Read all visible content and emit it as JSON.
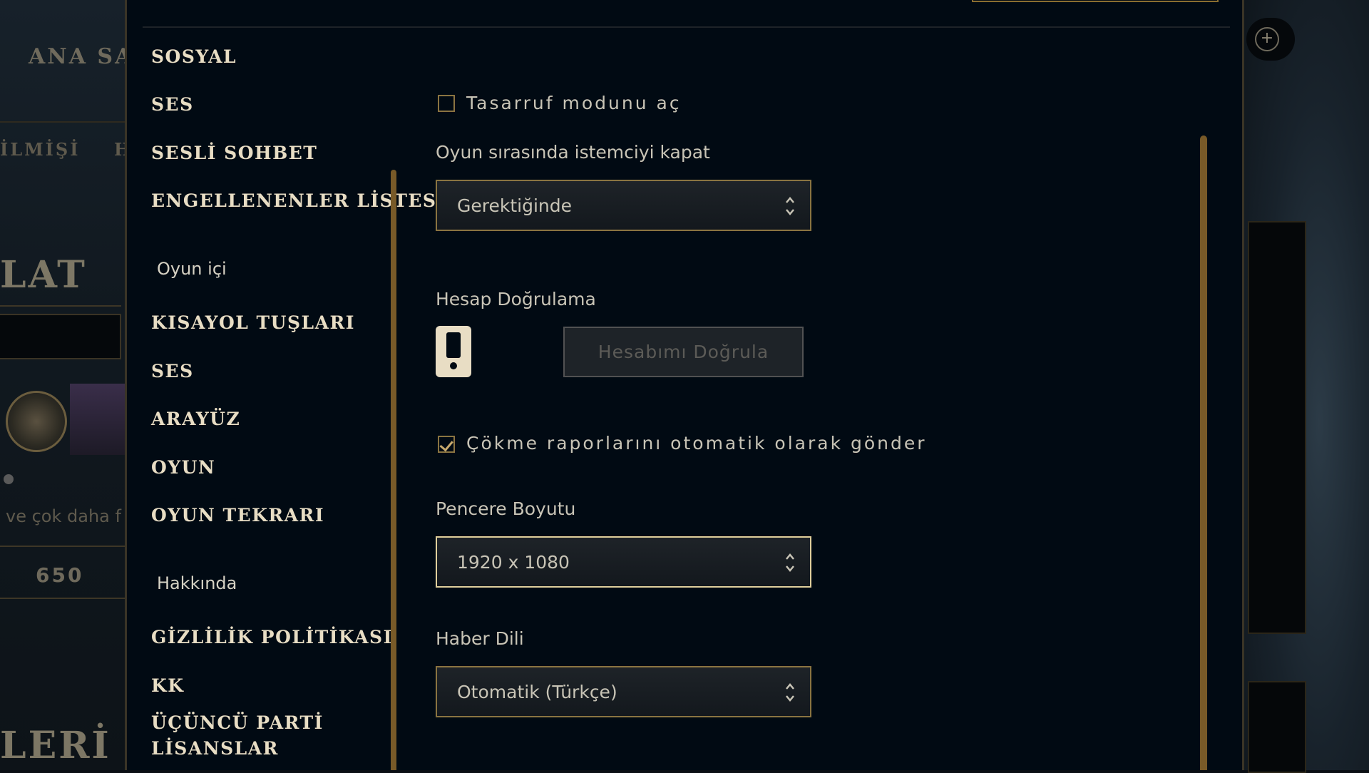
{
  "background": {
    "home_label": "ANA SAY",
    "history_label": "İLMİŞİ",
    "tab_h": "H",
    "section_title": "LAT",
    "promo_text": "ve çok daha f",
    "currency_value": "650",
    "bottom_title": "LERİ"
  },
  "sidebar": {
    "items": [
      {
        "label": "SOSYAL"
      },
      {
        "label": "SES"
      },
      {
        "label": "SESLİ SOHBET"
      },
      {
        "label": "ENGELLENENLER LİSTESİ"
      },
      {
        "label": "KISAYOL TUŞLARI"
      },
      {
        "label": "SES"
      },
      {
        "label": "ARAYÜZ"
      },
      {
        "label": "OYUN"
      },
      {
        "label": "OYUN TEKRARI"
      },
      {
        "label": "GİZLİLİK POLİTİKASI"
      },
      {
        "label": "KK"
      },
      {
        "label": "ÜÇÜNCÜ PARTİ"
      },
      {
        "label": "LİSANSLAR"
      }
    ],
    "section_in_game": "Oyun içi",
    "section_about": "Hakkında"
  },
  "content": {
    "power_save": {
      "label": "Tasarruf modunu aç",
      "checked": false
    },
    "close_client": {
      "label": "Oyun sırasında istemciyi kapat",
      "selected": "Gerektiğinde"
    },
    "account_verification": {
      "label": "Hesap Doğrulama",
      "phone_icon": "phone-icon",
      "status_icon": "x-icon",
      "button_label": "Hesabımı Doğrula"
    },
    "crash_reports": {
      "label": "Çökme raporlarını otomatik olarak gönder",
      "checked": true
    },
    "window_size": {
      "label": "Pencere Boyutu",
      "selected": "1920 x 1080"
    },
    "news_language": {
      "label": "Haber Dili",
      "selected": "Otomatik (Türkçe)"
    }
  },
  "colors": {
    "gold": "#c8aa6e",
    "gold_dark": "#785a28",
    "text": "#c8c4b6",
    "error_red": "#d61f3a",
    "modal_bg": "#010a13"
  }
}
